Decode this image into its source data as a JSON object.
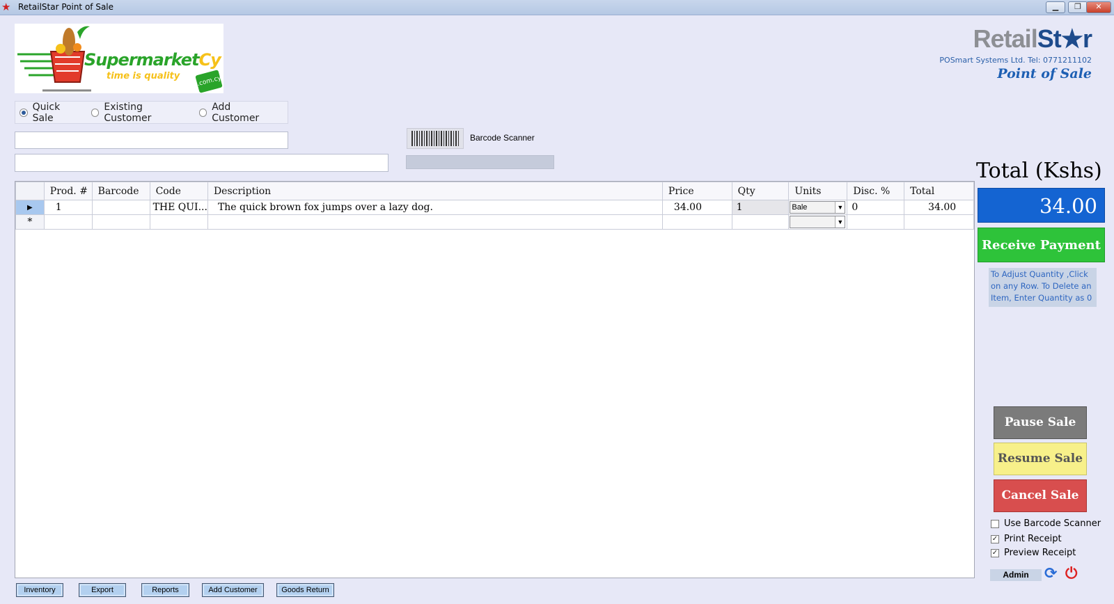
{
  "window": {
    "title": "RetailStar Point of Sale",
    "minimize": "▁",
    "restore": "❐",
    "close": "✕"
  },
  "logo": {
    "word_main": "Supermarket",
    "word_accent": "Cy",
    "tagline": "time is quality",
    "badge": ".com.cy"
  },
  "brand": {
    "name_main": "Retail",
    "name_accent": "St★r",
    "company": "POSmart Systems Ltd.  Tel:  0771211102",
    "product": "Point of Sale"
  },
  "customer_modes": [
    {
      "label": "Quick Sale",
      "checked": true
    },
    {
      "label": "Existing Customer",
      "checked": false
    },
    {
      "label": "Add Customer",
      "checked": false
    }
  ],
  "barcode": {
    "label": "Barcode Scanner"
  },
  "grid": {
    "columns": [
      "Prod. #",
      "Barcode",
      "Code",
      "Description",
      "Price",
      "Qty",
      "Units",
      "Disc. %",
      "Total"
    ],
    "rows": [
      {
        "indicator": "▶",
        "prod": "1",
        "barcode": "",
        "code": "THE QUI...",
        "description": "The quick brown fox jumps over a lazy dog.",
        "price": "34.00",
        "qty": "1",
        "units": "Bale",
        "disc": "0",
        "total": "34.00"
      },
      {
        "indicator": "*",
        "prod": "",
        "barcode": "",
        "code": "",
        "description": "",
        "price": "",
        "qty": "",
        "units": "",
        "disc": "",
        "total": ""
      }
    ]
  },
  "totals": {
    "label": "Total  (Kshs)",
    "value": "34.00"
  },
  "actions": {
    "receive_payment": "Receive Payment",
    "hint": "To Adjust Quantity ,Click on any Row. To Delete an Item, Enter Quantity as 0",
    "pause": "Pause Sale",
    "resume": "Resume Sale",
    "cancel": "Cancel Sale"
  },
  "options": [
    {
      "label": "Use Barcode Scanner",
      "checked": false
    },
    {
      "label": "Print Receipt",
      "checked": true
    },
    {
      "label": "Preview Receipt",
      "checked": true
    }
  ],
  "user": {
    "name": "Admin",
    "refresh_icon": "⟳",
    "power_icon": "⏻"
  },
  "bottom_buttons": [
    "Inventory",
    "Export",
    "Reports",
    "Add Customer",
    "Goods Return"
  ],
  "colors": {
    "background": "#e7e8f7",
    "total_bg": "#1464d2",
    "receive_bg": "#2ec33a",
    "pause_bg": "#7b7b7b",
    "resume_bg": "#f7f08a",
    "cancel_bg": "#d84e4e",
    "bottom_btn_bg": "#b3d0ef"
  }
}
